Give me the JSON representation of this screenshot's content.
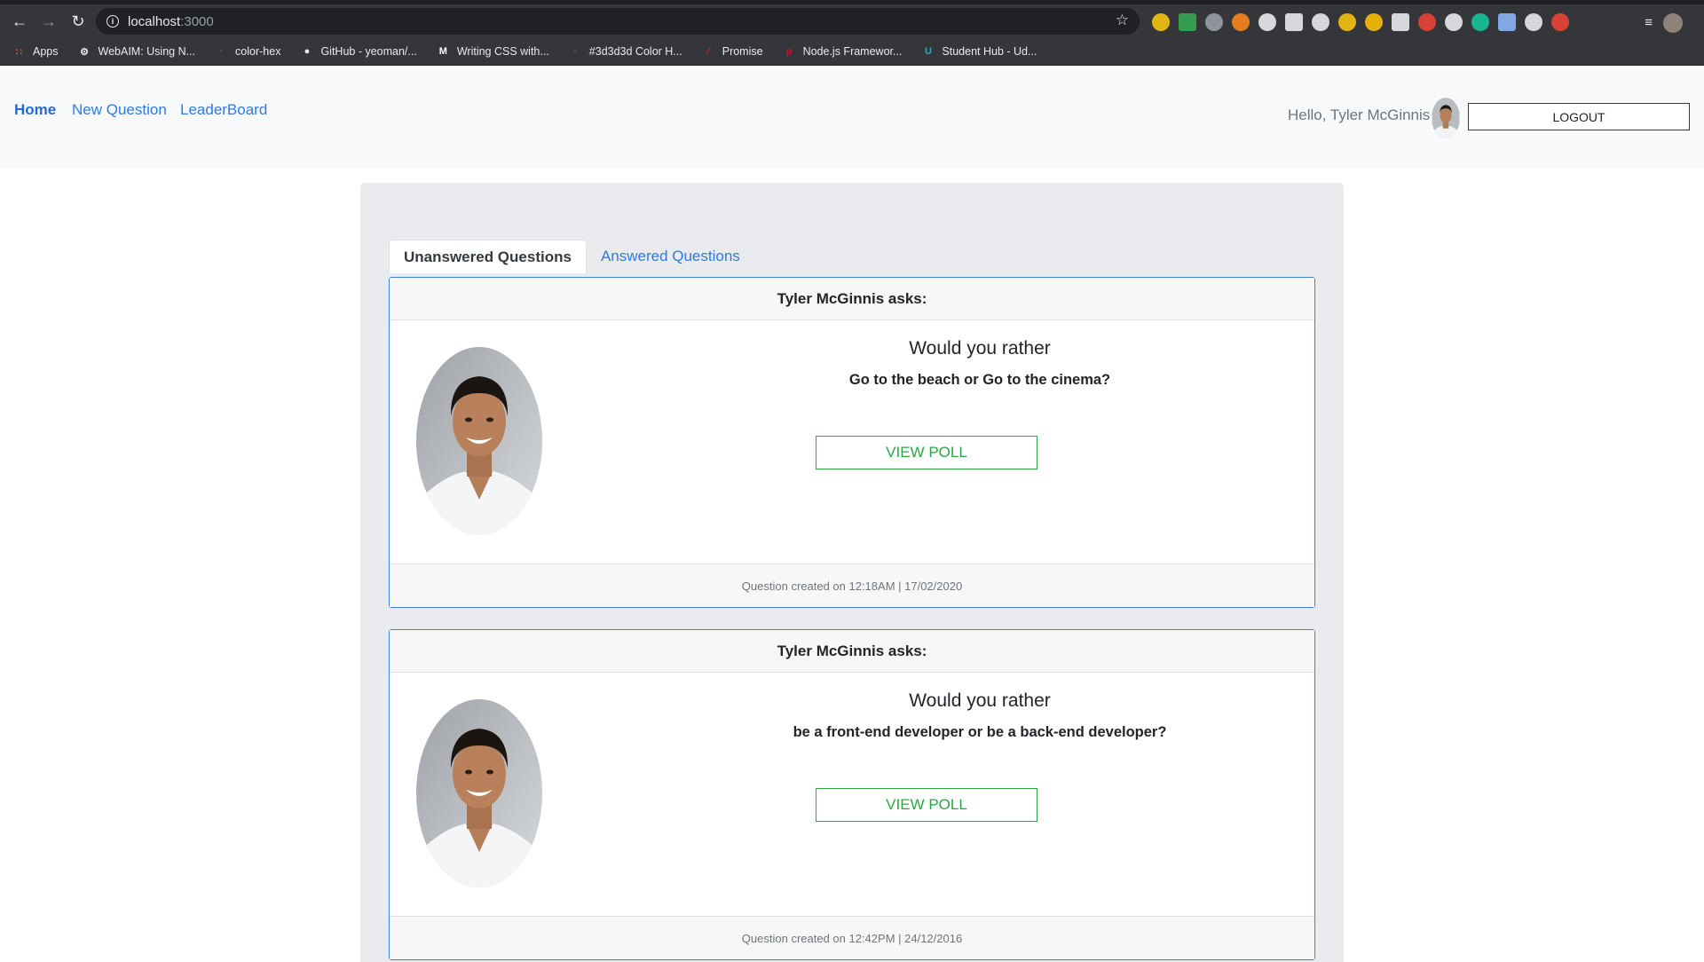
{
  "browser": {
    "url_host": "localhost",
    "url_port": ":3000",
    "bookmarks": [
      {
        "label": "Apps",
        "icon": "apps-grid-icon",
        "color": "#e8453c"
      },
      {
        "label": "WebAIM: Using N...",
        "icon": "gear-icon",
        "color": "#e8eaed"
      },
      {
        "label": "color-hex",
        "icon": "colorhex-icon",
        "color": "#5f6368"
      },
      {
        "label": "GitHub - yeoman/...",
        "icon": "github-icon",
        "color": "#e8eaed"
      },
      {
        "label": "Writing CSS with...",
        "icon": "medium-icon",
        "color": "#ffffff"
      },
      {
        "label": "#3d3d3d Color H...",
        "icon": "colorhex-icon",
        "color": "#5f6368"
      },
      {
        "label": "Promise",
        "icon": "promise-icon",
        "color": "#c62828"
      },
      {
        "label": "Node.js Framewor...",
        "icon": "pinterest-icon",
        "color": "#e60023"
      },
      {
        "label": "Student Hub - Ud...",
        "icon": "udacity-icon",
        "color": "#2aa6c9"
      }
    ],
    "extension_colors": [
      "#f4c20d",
      "#34a853",
      "#9aa0a6",
      "#f6851b",
      "#e8eaed",
      "#e8eaed",
      "#e8eaed",
      "#f4c20d",
      "#fbbc05",
      "#e8eaed",
      "#ea4335",
      "#e8eaed",
      "#15c39a",
      "#8ab4f8",
      "#e8eaed",
      "#ea4335"
    ]
  },
  "nav": {
    "home": "Home",
    "new_question": "New Question",
    "leaderboard": "LeaderBoard",
    "hello": "Hello, Tyler McGinnis",
    "logout": "LOGOUT"
  },
  "tabs": {
    "unanswered": "Unanswered Questions",
    "answered": "Answered Questions"
  },
  "questions": [
    {
      "header": "Tyler McGinnis asks:",
      "title": "Would you rather",
      "options": "Go to the beach or Go to the cinema?",
      "button": "VIEW POLL",
      "footer": "Question created on 12:18AM | 17/02/2020"
    },
    {
      "header": "Tyler McGinnis asks:",
      "title": "Would you rather",
      "options": "be a front-end developer or be a back-end developer?",
      "button": "VIEW POLL",
      "footer": "Question created on 12:42PM | 24/12/2016"
    }
  ],
  "colors": {
    "link": "#2f7ae5",
    "card_border": "#3f7fe0",
    "button_green": "#28a745",
    "panel_bg": "#e9ebee"
  }
}
